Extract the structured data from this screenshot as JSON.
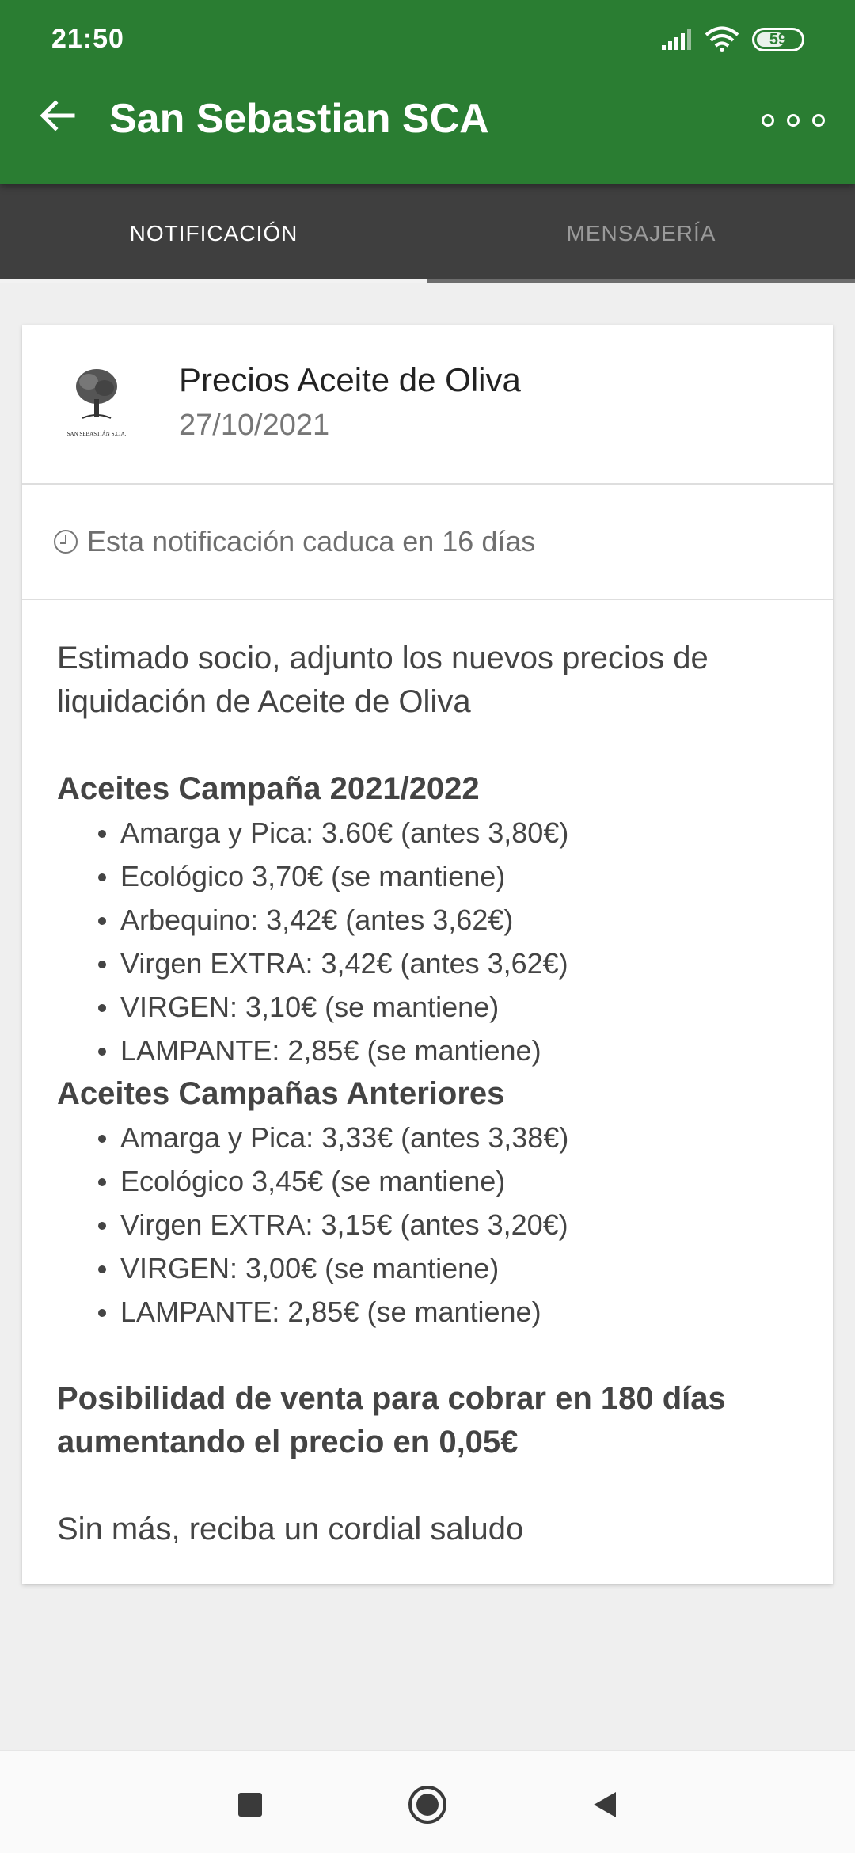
{
  "status_bar": {
    "time": "21:50",
    "battery": "59",
    "icons": [
      "signal-icon",
      "wifi-icon",
      "battery-icon"
    ]
  },
  "app_bar": {
    "title": "San Sebastian SCA",
    "back_icon": "arrow-left-icon",
    "more_icon": "more-dots-icon",
    "color": "#2a7d32"
  },
  "tabs": [
    {
      "label": "NOTIFICACIÓN",
      "active": true
    },
    {
      "label": "MENSAJERÍA",
      "active": false
    }
  ],
  "notification": {
    "logo_text": "SAN SEBASTIÁN S.C.A.",
    "title": "Precios Aceite de Oliva",
    "date": "27/10/2021",
    "expiry": "Esta notificación caduca en 16 días",
    "intro": "Estimado socio, adjunto los nuevos precios de liquidación de Aceite de Oliva",
    "sections": [
      {
        "heading": "Aceites Campaña 2021/2022",
        "items": [
          "Amarga y Pica: 3.60€ (antes 3,80€)",
          "Ecológico 3,70€ (se mantiene)",
          "Arbequino: 3,42€ (antes 3,62€)",
          "Virgen EXTRA: 3,42€ (antes 3,62€)",
          "VIRGEN: 3,10€ (se mantiene)",
          "LAMPANTE: 2,85€ (se mantiene)"
        ]
      },
      {
        "heading": "Aceites Campañas Anteriores",
        "items": [
          "Amarga y Pica: 3,33€ (antes 3,38€)",
          "Ecológico 3,45€ (se mantiene)",
          "Virgen EXTRA: 3,15€ (antes 3,20€)",
          "VIRGEN: 3,00€ (se mantiene)",
          "LAMPANTE: 2,85€ (se mantiene)"
        ]
      }
    ],
    "note": "Posibilidad de venta para cobrar en 180 días aumentando el precio en 0,05€",
    "closing": "Sin más, reciba un cordial saludo"
  },
  "nav_bar": {
    "buttons": [
      "recents-square-icon",
      "home-circle-icon",
      "back-triangle-icon"
    ]
  }
}
